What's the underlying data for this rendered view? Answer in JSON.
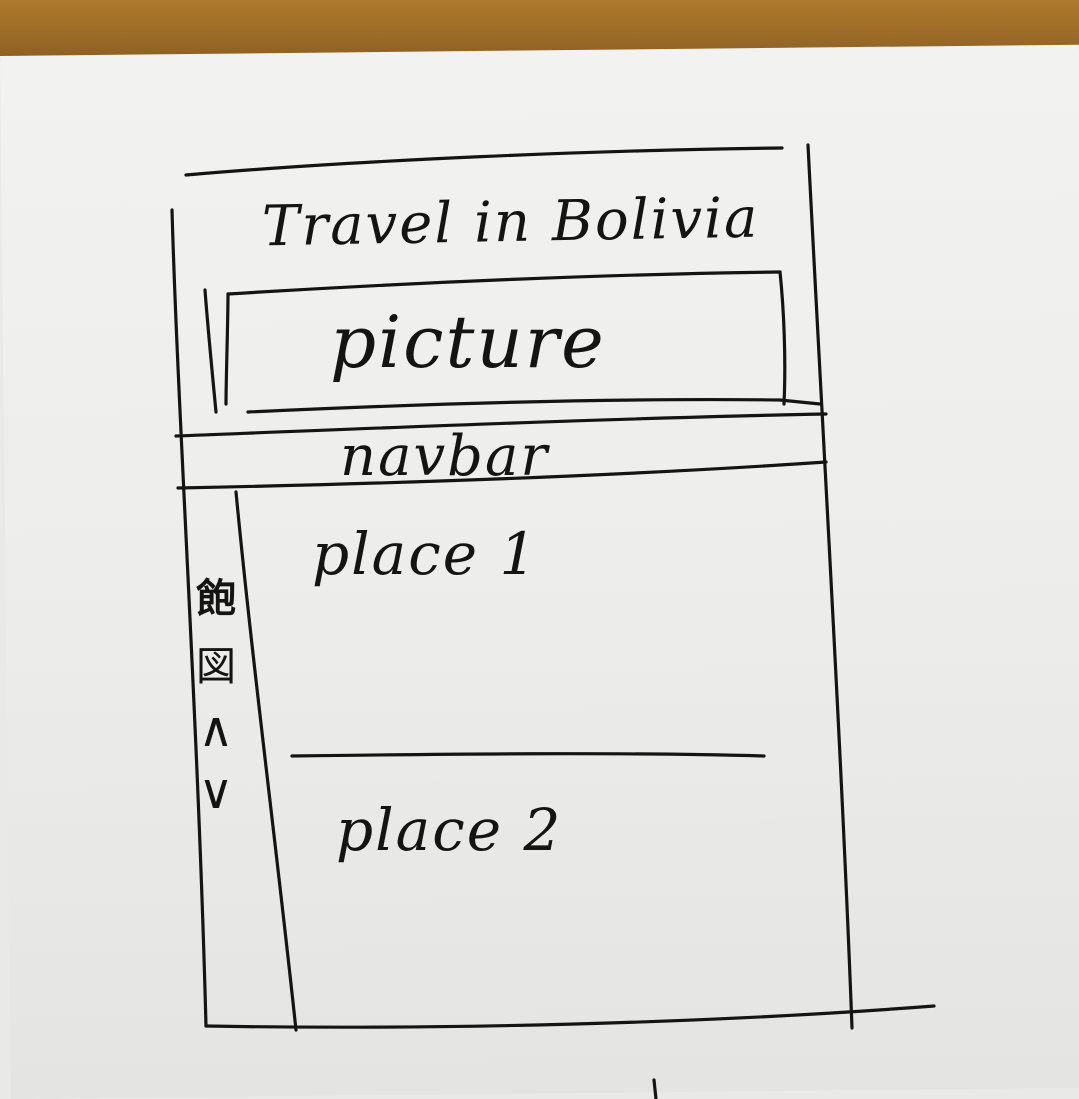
{
  "sketch": {
    "title": "Travel in Bolivia",
    "picture_label": "picture",
    "navbar_label": "navbar",
    "sections": [
      {
        "label": "place 1"
      },
      {
        "label": "place 2"
      }
    ],
    "side_nav": {
      "glyphs": [
        "飽",
        "図",
        "∧",
        "∨"
      ]
    }
  }
}
